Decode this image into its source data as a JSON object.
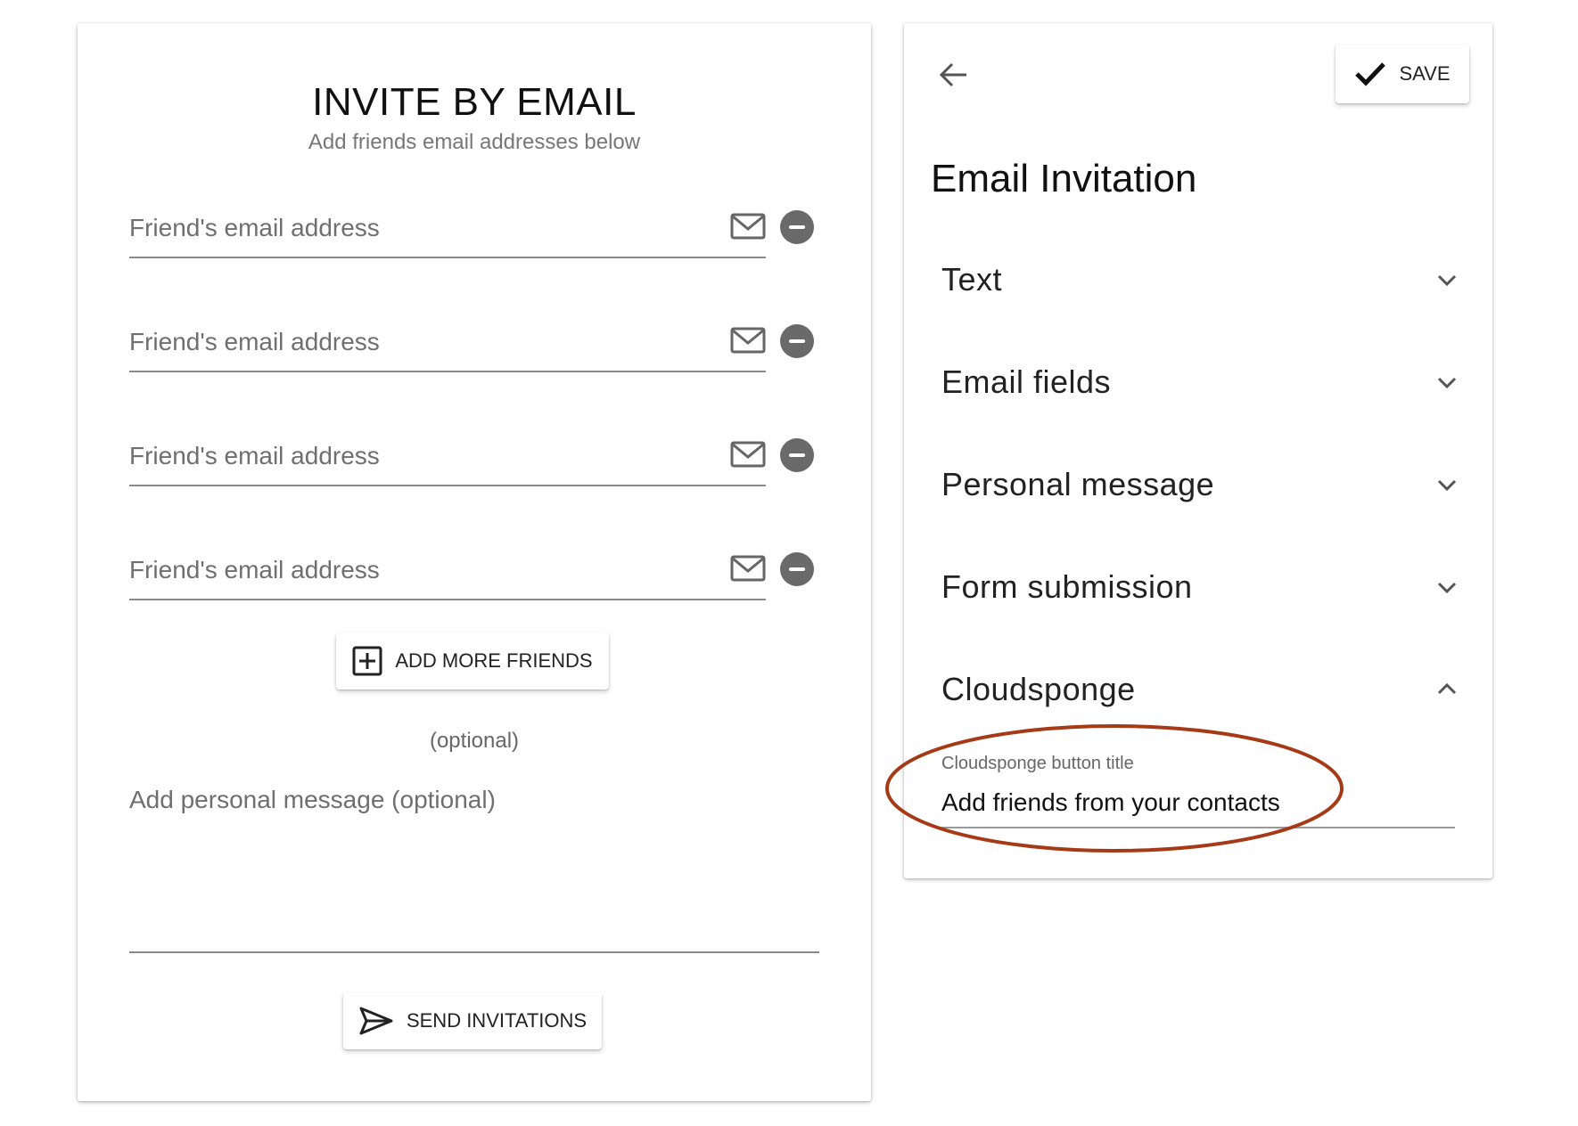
{
  "invite": {
    "title": "INVITE BY EMAIL",
    "subtitle": "Add friends email addresses below",
    "email_placeholder": "Friend's email address",
    "email_fields": [
      {
        "placeholder": "Friend's email address"
      },
      {
        "placeholder": "Friend's email address"
      },
      {
        "placeholder": "Friend's email address"
      },
      {
        "placeholder": "Friend's email address"
      }
    ],
    "add_more_label": "ADD MORE FRIENDS",
    "optional_label": "(optional)",
    "message_placeholder": "Add personal message (optional)",
    "send_label": "SEND INVITATIONS"
  },
  "editor": {
    "save_label": "SAVE",
    "title": "Email Invitation",
    "sections": [
      {
        "label": "Text",
        "expanded": false
      },
      {
        "label": "Email fields",
        "expanded": false
      },
      {
        "label": "Personal message",
        "expanded": false
      },
      {
        "label": "Form submission",
        "expanded": false
      },
      {
        "label": "Cloudsponge",
        "expanded": true
      }
    ],
    "cloudsponge_field": {
      "label": "Cloudsponge button title",
      "value": "Add friends from your contacts"
    }
  },
  "colors": {
    "annotation_ring": "#a63a16",
    "remove_button": "#6a6a6a"
  },
  "icons": [
    "mail-icon",
    "remove-icon",
    "add-box-icon",
    "send-icon",
    "back-arrow-icon",
    "check-icon",
    "chevron-down-icon",
    "chevron-up-icon"
  ]
}
